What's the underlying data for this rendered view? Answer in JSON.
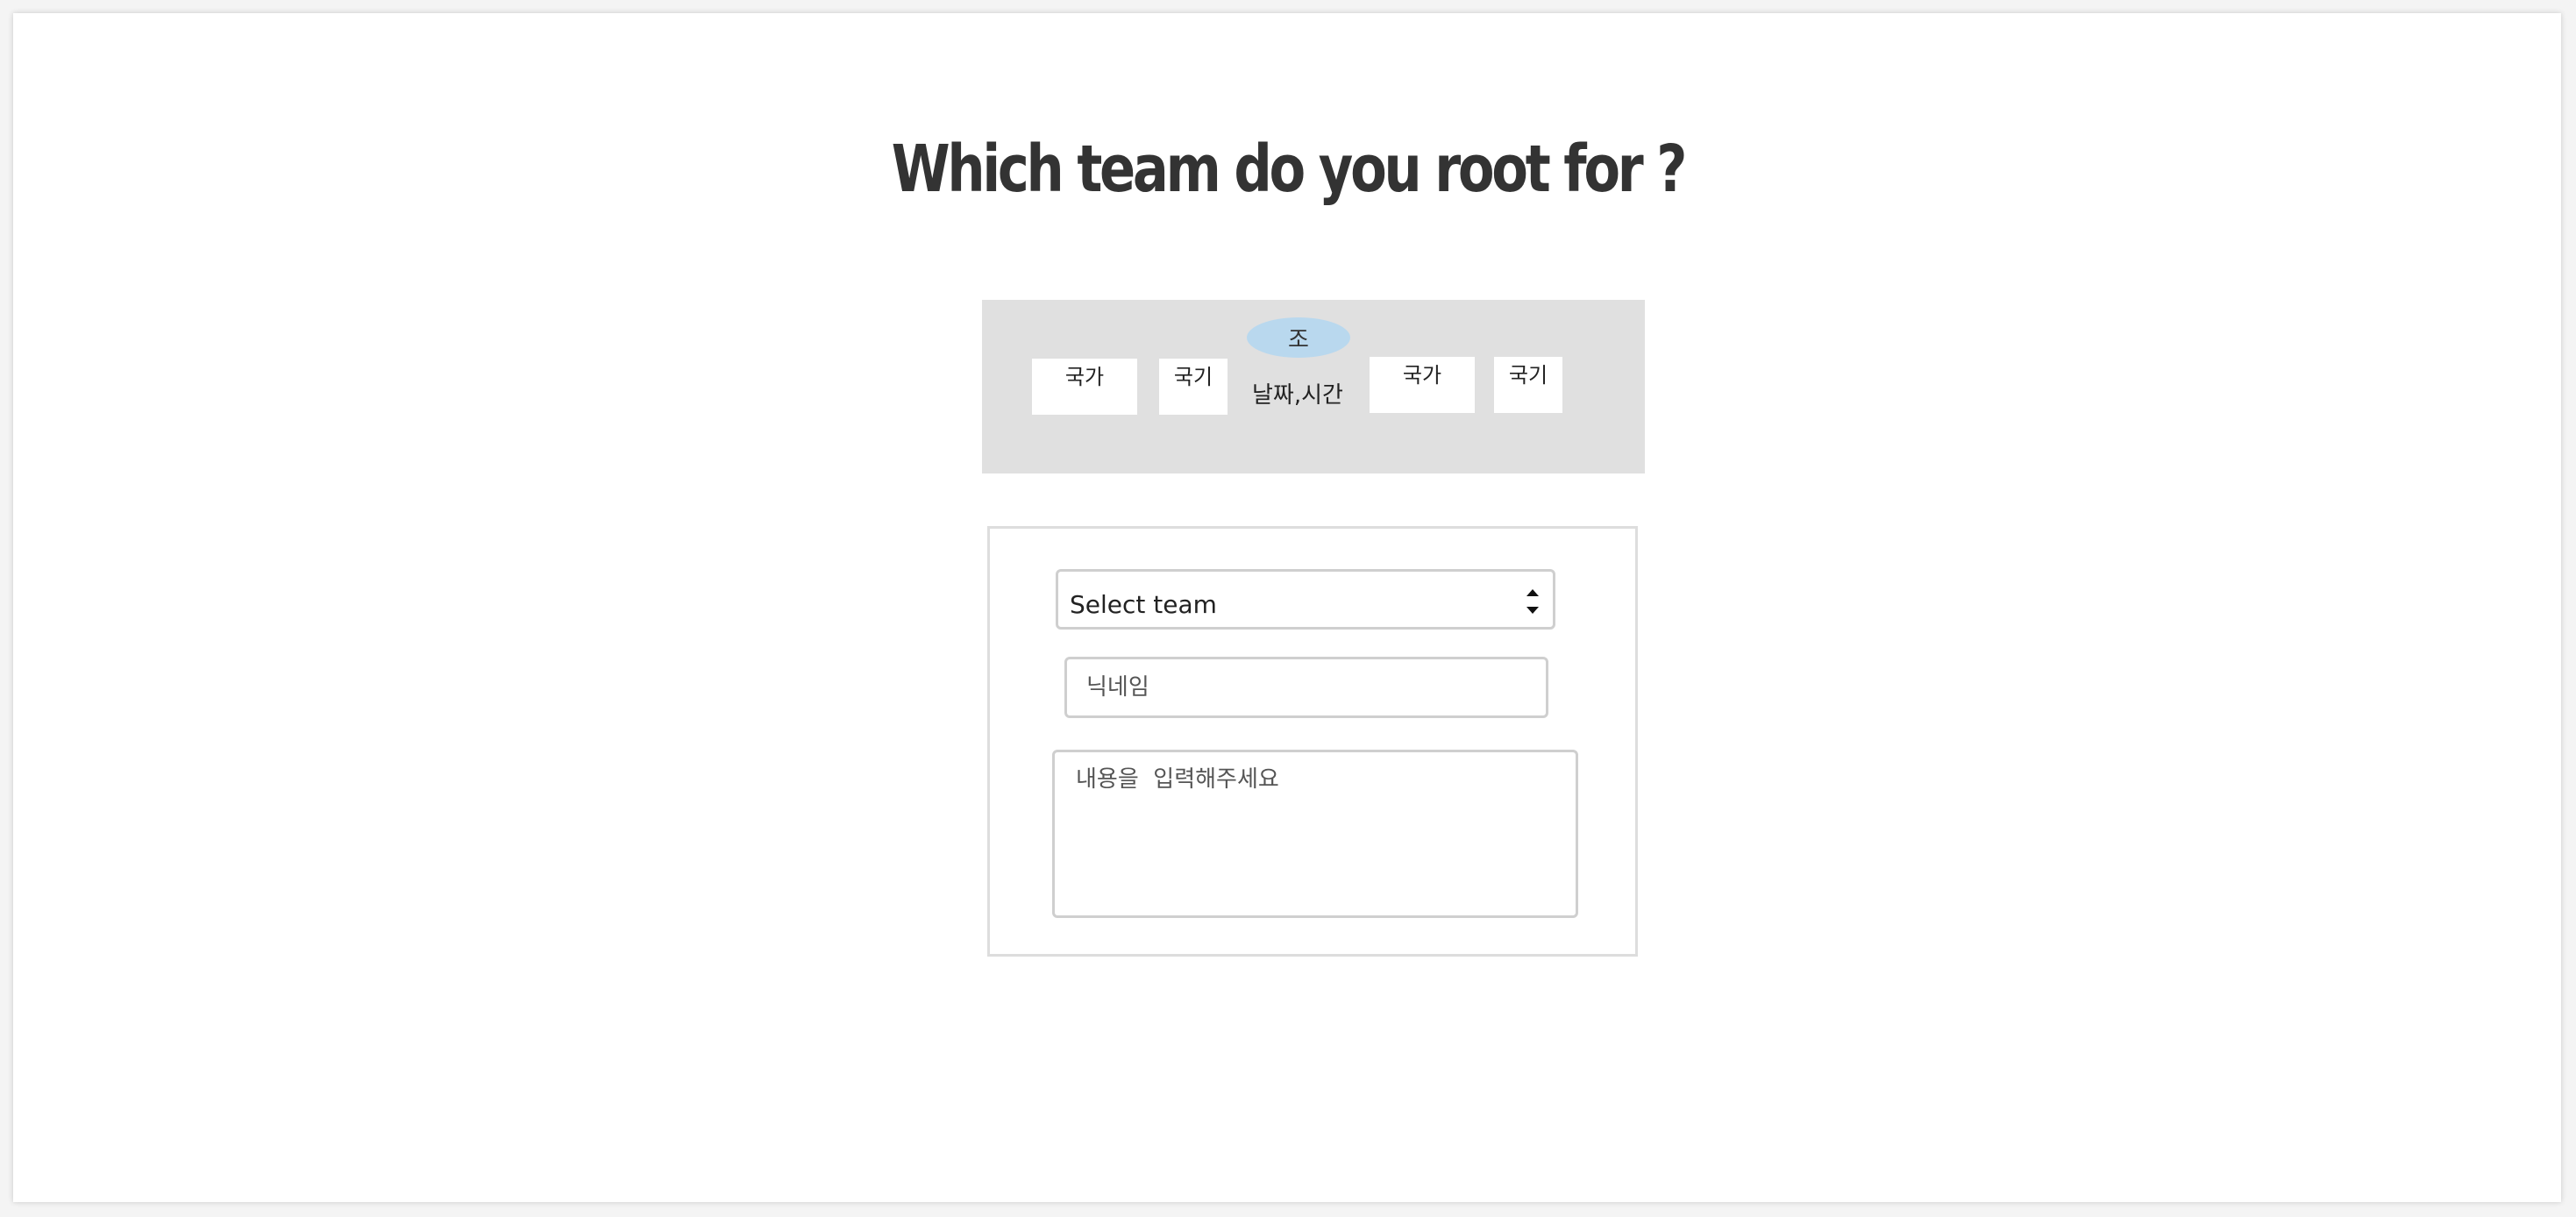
{
  "page": {
    "title": "Which team do you root for ?"
  },
  "match": {
    "group": "조",
    "team1_country": "국가",
    "team1_flag": "국기",
    "datetime": "날짜,시간",
    "team2_country": "국가",
    "team2_flag": "국기"
  },
  "form": {
    "team_select": {
      "selected": "Select team",
      "options": [
        "Select team"
      ]
    },
    "nickname": {
      "placeholder": "닉네임",
      "value": ""
    },
    "content": {
      "placeholder": "내용을  입력해주세요",
      "value": ""
    }
  },
  "colors": {
    "title": "#333333",
    "match_card_bg": "#e0e0e0",
    "group_pill_bg": "#b9d8ee",
    "input_border": "#cfcfcf"
  },
  "icons": {
    "select_arrows": "up-down-arrows-icon"
  }
}
